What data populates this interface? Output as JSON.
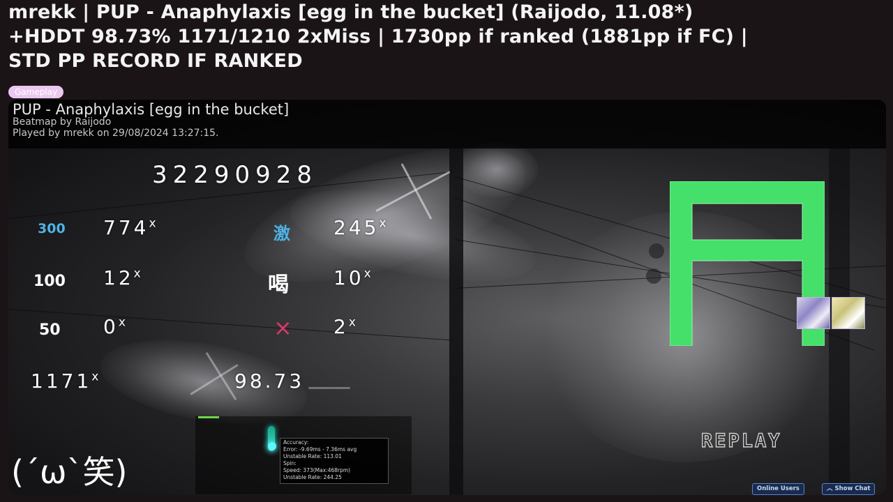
{
  "post": {
    "title_line1": "mrekk | PUP - Anaphylaxis [egg in the bucket] (Raijodo, 11.08*)",
    "title_line2": "+HDDT 98.73% 1171/1210 2xMiss | 1730pp if ranked (1881pp if FC) |",
    "title_line3": "STD PP RECORD IF RANKED",
    "flair": "Gameplay",
    "flair_color": "#ebc8ef"
  },
  "ranking": {
    "song_title": "PUP - Anaphylaxis [egg in the bucket]",
    "beatmap_by": "Beatmap by Raijodo",
    "played_by": "Played by mrekk on 29/08/2024 13:27:15.",
    "score": "32290928",
    "hits": {
      "h300": {
        "icon": "300",
        "count": "774",
        "suffix": "x"
      },
      "geki": {
        "icon": "激",
        "count": "245",
        "suffix": "x"
      },
      "h100": {
        "icon": "100",
        "count": "12",
        "suffix": "x"
      },
      "katu": {
        "icon": "喝",
        "count": "10",
        "suffix": "x"
      },
      "h50": {
        "icon": "50",
        "count": "0",
        "suffix": "x"
      },
      "miss": {
        "icon": "×",
        "count": "2",
        "suffix": "x"
      }
    },
    "combo": "1171",
    "combo_suffix": "x",
    "accuracy": "98.73",
    "grade": "A",
    "grade_color": "#44e06a",
    "replay_label": "REPLAY",
    "kaomoji": "(´ω`笑)",
    "tooltip": {
      "line1": "Accuracy:",
      "line2": "Error: -9.69ms - 7.36ms avg",
      "line3": "Unstable Rate: 113.01",
      "line4": "Spin:",
      "line5": "Speed: 373(Max:468rpm)",
      "line6": "Unstable Rate: 244.25"
    },
    "buttons": {
      "online_users": "Online Users",
      "show_chat": "Show Chat"
    },
    "colors": {
      "h300": "#4fb3e6",
      "miss": "#d83a6a",
      "panel_bg": "#000000"
    }
  }
}
